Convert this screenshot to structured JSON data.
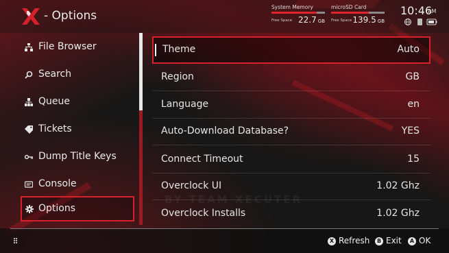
{
  "header": {
    "title": "- Options",
    "storage": [
      {
        "label": "System Memory",
        "free_label": "Free Space",
        "value": "22.7",
        "unit": "GB",
        "used_fraction": 0.85
      },
      {
        "label": "microSD Card",
        "free_label": "Free Space",
        "value": "139.5",
        "unit": "GB",
        "used_fraction": 0.7
      }
    ],
    "time": "10:46",
    "ampm": "AM"
  },
  "sidebar": {
    "items": [
      {
        "label": "File Browser",
        "icon": "file-browser-icon"
      },
      {
        "label": "Search",
        "icon": "search-icon"
      },
      {
        "label": "Queue",
        "icon": "queue-icon"
      },
      {
        "label": "Tickets",
        "icon": "ticket-icon"
      },
      {
        "label": "Dump Title Keys",
        "icon": "key-icon"
      },
      {
        "label": "Console",
        "icon": "console-icon"
      },
      {
        "label": "Options",
        "icon": "gear-icon",
        "active": true
      }
    ]
  },
  "options": [
    {
      "label": "Theme",
      "value": "Auto",
      "selected": true
    },
    {
      "label": "Region",
      "value": "GB"
    },
    {
      "label": "Language",
      "value": "en"
    },
    {
      "label": "Auto-Download Database?",
      "value": "YES"
    },
    {
      "label": "Connect Timeout",
      "value": "15"
    },
    {
      "label": "Overclock UI",
      "value": "1.02 Ghz"
    },
    {
      "label": "Overclock Installs",
      "value": "1.02 Ghz"
    }
  ],
  "watermark": "BY TEAM XECUTER",
  "footer": {
    "hints": [
      {
        "button": "X",
        "label": "Refresh"
      },
      {
        "button": "B",
        "label": "Exit"
      },
      {
        "button": "A",
        "label": "OK"
      }
    ]
  },
  "colors": {
    "accent": "#d6202c",
    "background": "#171717"
  }
}
